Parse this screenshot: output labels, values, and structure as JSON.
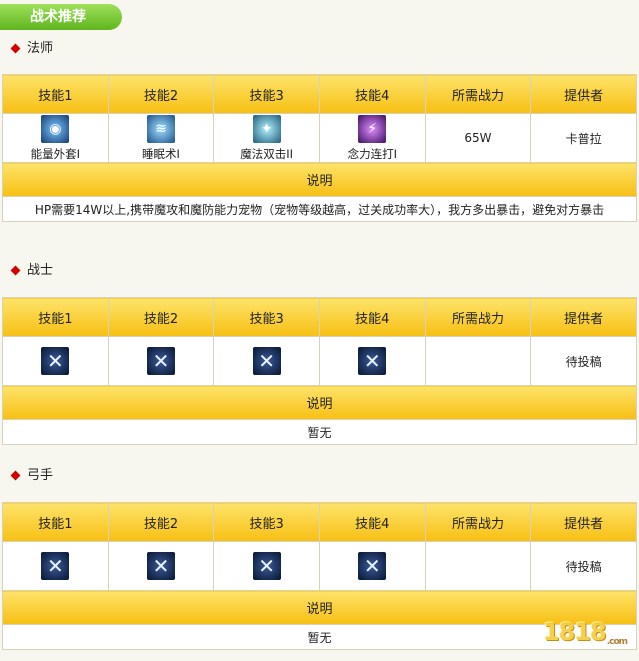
{
  "header": {
    "title": "战术推荐"
  },
  "columns": [
    "技能1",
    "技能2",
    "技能3",
    "技能4",
    "所需战力",
    "提供者"
  ],
  "desc_header": "说明",
  "sections": [
    {
      "name": "法师",
      "skills": [
        {
          "label": "能量外套I",
          "icon": "energy-coat-icon",
          "glyph": "◉"
        },
        {
          "label": "睡眠术I",
          "icon": "sleep-icon",
          "glyph": "≋"
        },
        {
          "label": "魔法双击II",
          "icon": "magic-double-strike-icon",
          "glyph": "✦"
        },
        {
          "label": "念力连打I",
          "icon": "telekinesis-combo-icon",
          "glyph": "⚡"
        }
      ],
      "power": "65W",
      "provider": "卡普拉",
      "description": "HP需要14W以上,携带魔攻和魔防能力宠物（宠物等级越高，过关成功率大），我方多出暴击，避免对方暴击"
    },
    {
      "name": "战士",
      "skills": [
        {
          "label": "",
          "icon": "empty-skill-icon",
          "glyph": "✕"
        },
        {
          "label": "",
          "icon": "empty-skill-icon",
          "glyph": "✕"
        },
        {
          "label": "",
          "icon": "empty-skill-icon",
          "glyph": "✕"
        },
        {
          "label": "",
          "icon": "empty-skill-icon",
          "glyph": "✕"
        }
      ],
      "power": "",
      "provider": "待投稿",
      "description": "暂无"
    },
    {
      "name": "弓手",
      "skills": [
        {
          "label": "",
          "icon": "empty-skill-icon",
          "glyph": "✕"
        },
        {
          "label": "",
          "icon": "empty-skill-icon",
          "glyph": "✕"
        },
        {
          "label": "",
          "icon": "empty-skill-icon",
          "glyph": "✕"
        },
        {
          "label": "",
          "icon": "empty-skill-icon",
          "glyph": "✕"
        }
      ],
      "power": "",
      "provider": "待投稿",
      "description": "暂无"
    }
  ],
  "watermark": {
    "main": "1818",
    "suffix": ".com"
  }
}
